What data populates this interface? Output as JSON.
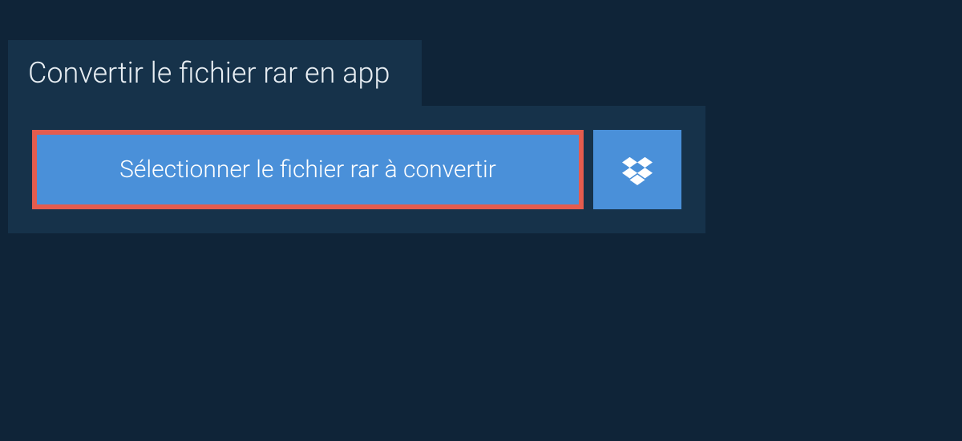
{
  "tab": {
    "title": "Convertir le fichier rar en app"
  },
  "actions": {
    "select_file_label": "Sélectionner le fichier rar à convertir"
  }
}
